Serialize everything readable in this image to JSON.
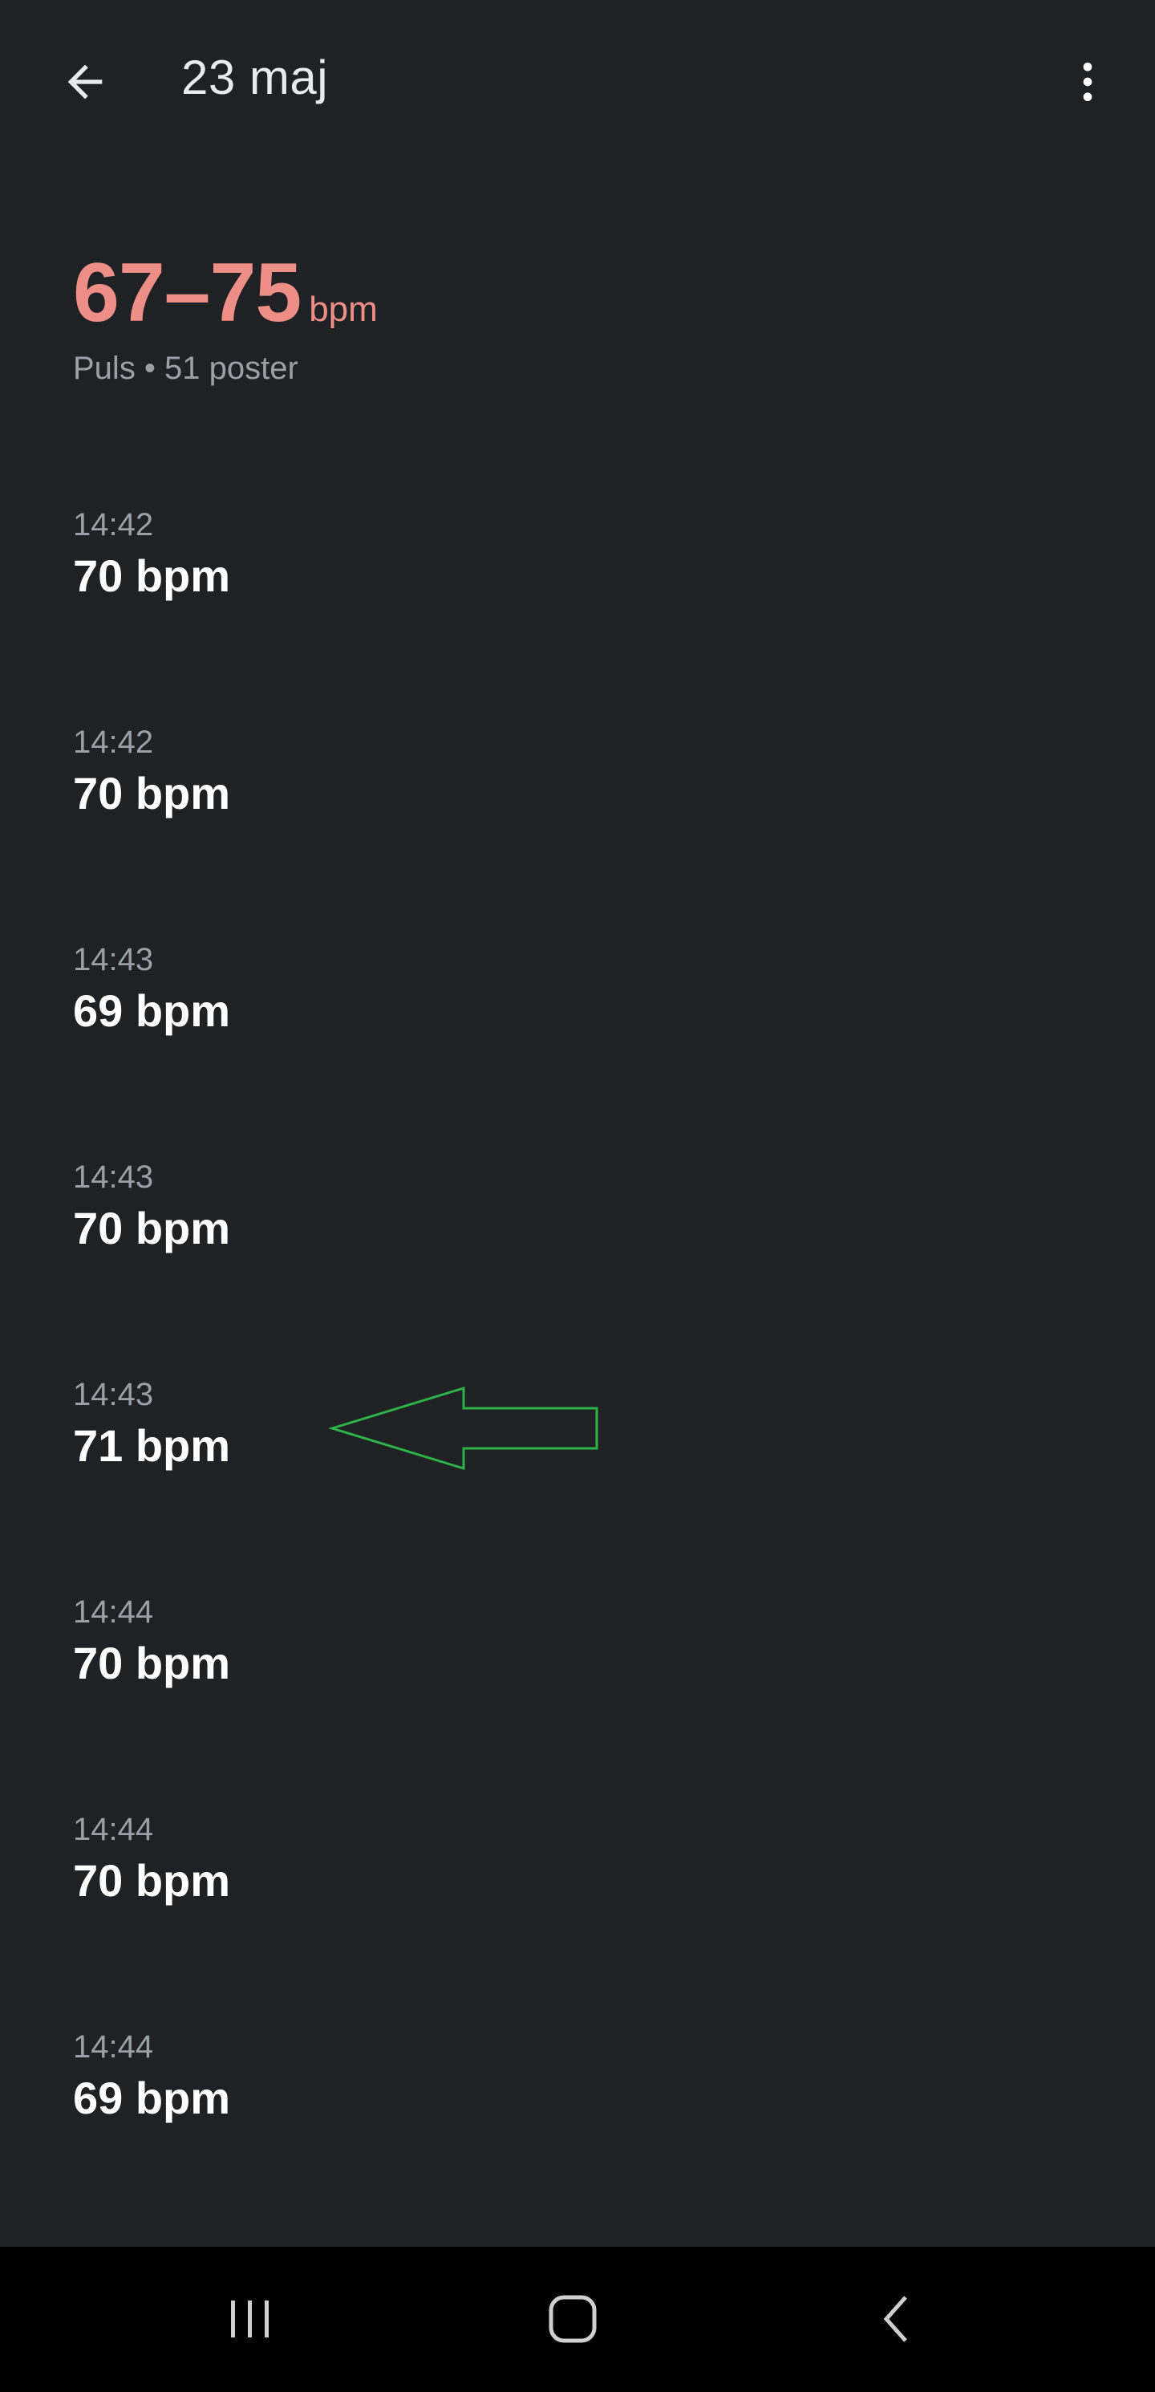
{
  "header": {
    "title": "23 maj",
    "back_icon": "arrow-back-icon",
    "more_icon": "more-vert-icon"
  },
  "summary": {
    "range": "67–75",
    "unit": "bpm",
    "subtitle": "Puls • 51 poster",
    "accent_color": "#ee8f87"
  },
  "records": [
    {
      "time": "14:42",
      "value": "70 bpm"
    },
    {
      "time": "14:42",
      "value": "70 bpm"
    },
    {
      "time": "14:43",
      "value": "69 bpm"
    },
    {
      "time": "14:43",
      "value": "70 bpm"
    },
    {
      "time": "14:43",
      "value": "71 bpm"
    },
    {
      "time": "14:44",
      "value": "70 bpm"
    },
    {
      "time": "14:44",
      "value": "70 bpm"
    },
    {
      "time": "14:44",
      "value": "69 bpm"
    }
  ],
  "annotation": {
    "icon": "green-arrow-annotation",
    "color": "#2db24a"
  },
  "navbar": {
    "recents_icon": "recents-icon",
    "home_icon": "home-icon",
    "back_icon": "nav-back-icon"
  }
}
